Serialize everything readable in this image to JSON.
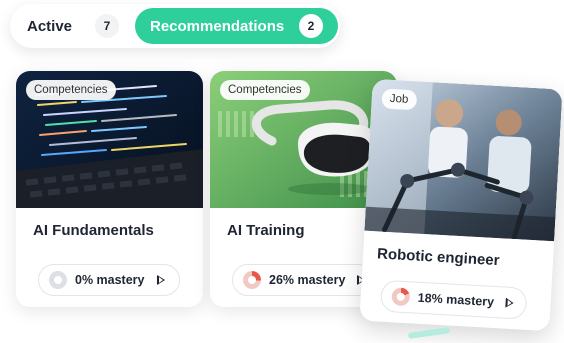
{
  "tabs": {
    "active": {
      "label": "Active",
      "count": "7"
    },
    "recommendations": {
      "label": "Recommendations",
      "count": "2"
    }
  },
  "cards": [
    {
      "tag": "Competencies",
      "title": "AI Fundamentals",
      "mastery": "0% mastery",
      "mastery_value": 0
    },
    {
      "tag": "Competencies",
      "title": "AI Training",
      "mastery": "26% mastery",
      "mastery_value": 26
    },
    {
      "tag": "Job",
      "title": "Robotic engineer",
      "mastery": "18% mastery",
      "mastery_value": 18
    }
  ],
  "colors": {
    "accent": "#2fcf9c",
    "mastery_fill": "#e8574a"
  }
}
